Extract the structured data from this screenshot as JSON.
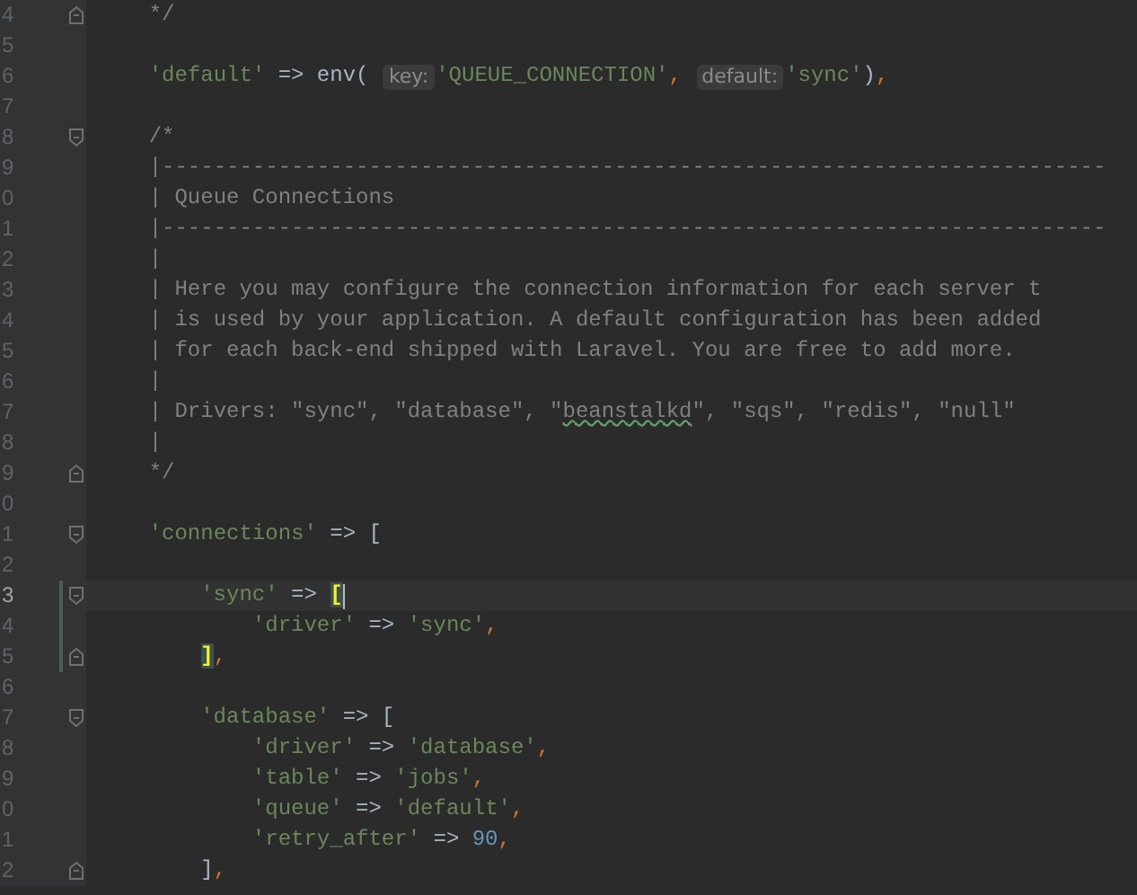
{
  "lines": [
    {
      "number": "4",
      "fold": {
        "kind": "end"
      },
      "current": false,
      "changed": false,
      "tokens": [
        {
          "t": "    */",
          "kind": "comment"
        }
      ]
    },
    {
      "number": "5",
      "current": false,
      "changed": false
    },
    {
      "number": "6",
      "current": false,
      "changed": false,
      "tokens": [
        {
          "t": "    'default'",
          "kind": "string"
        },
        {
          "t": " => env( ",
          "kind": "plain"
        },
        {
          "t": "key:",
          "kind": "hint"
        },
        {
          "t": "'QUEUE_CONNECTION'",
          "kind": "string"
        },
        {
          "t": ", ",
          "kind": "comma"
        },
        {
          "t": "default:",
          "kind": "hint"
        },
        {
          "t": "'sync'",
          "kind": "string"
        },
        {
          "t": ")",
          "kind": "plain"
        },
        {
          "t": ",",
          "kind": "comma"
        }
      ]
    },
    {
      "number": "7",
      "current": false,
      "changed": false
    },
    {
      "number": "8",
      "fold": {
        "kind": "start"
      },
      "current": false,
      "changed": false,
      "tokens": [
        {
          "t": "    /*",
          "kind": "comment"
        }
      ]
    },
    {
      "number": "9",
      "current": false,
      "changed": false,
      "tokens": [
        {
          "t": "    |-------------------------------------------------------------------------",
          "kind": "comment"
        }
      ]
    },
    {
      "number": "0",
      "current": false,
      "changed": false,
      "tokens": [
        {
          "t": "    | Queue Connections",
          "kind": "comment"
        }
      ]
    },
    {
      "number": "1",
      "current": false,
      "changed": false,
      "tokens": [
        {
          "t": "    |-------------------------------------------------------------------------",
          "kind": "comment"
        }
      ]
    },
    {
      "number": "2",
      "current": false,
      "changed": false,
      "tokens": [
        {
          "t": "    |",
          "kind": "comment"
        }
      ]
    },
    {
      "number": "3",
      "current": false,
      "changed": false,
      "tokens": [
        {
          "t": "    | Here you may configure the connection information for each server t",
          "kind": "comment"
        }
      ]
    },
    {
      "number": "4",
      "current": false,
      "changed": false,
      "tokens": [
        {
          "t": "    | is used by your application. A default configuration has been added",
          "kind": "comment"
        }
      ]
    },
    {
      "number": "5",
      "current": false,
      "changed": false,
      "tokens": [
        {
          "t": "    | for each back-end shipped with Laravel. You are free to add more.",
          "kind": "comment"
        }
      ]
    },
    {
      "number": "6",
      "current": false,
      "changed": false,
      "tokens": [
        {
          "t": "    |",
          "kind": "comment"
        }
      ]
    },
    {
      "number": "7",
      "current": false,
      "changed": false,
      "tokens": [
        {
          "t": "    | Drivers: \"sync\", \"database\", \"",
          "kind": "comment"
        },
        {
          "t": "beanstalkd",
          "kind": "typo"
        },
        {
          "t": "\", \"sqs\", \"redis\", \"null\"",
          "kind": "comment"
        }
      ]
    },
    {
      "number": "8",
      "current": false,
      "changed": false,
      "tokens": [
        {
          "t": "    |",
          "kind": "comment"
        }
      ]
    },
    {
      "number": "9",
      "fold": {
        "kind": "end"
      },
      "current": false,
      "changed": false,
      "tokens": [
        {
          "t": "    */",
          "kind": "comment"
        }
      ]
    },
    {
      "number": "0",
      "current": false,
      "changed": false
    },
    {
      "number": "1",
      "fold": {
        "kind": "start"
      },
      "current": false,
      "changed": false,
      "tokens": [
        {
          "t": "    'connections'",
          "kind": "string"
        },
        {
          "t": " => [",
          "kind": "plain"
        }
      ]
    },
    {
      "number": "2",
      "current": false,
      "changed": false
    },
    {
      "number": "3",
      "fold": {
        "kind": "start"
      },
      "current": true,
      "changed": true,
      "tokens": [
        {
          "t": "        'sync'",
          "kind": "string"
        },
        {
          "t": " => ",
          "kind": "plain"
        },
        {
          "t": "[",
          "kind": "match"
        }
      ]
    },
    {
      "number": "4",
      "current": false,
      "changed": true,
      "tokens": [
        {
          "t": "            'driver'",
          "kind": "string"
        },
        {
          "t": " => ",
          "kind": "plain"
        },
        {
          "t": "'sync'",
          "kind": "string"
        },
        {
          "t": ",",
          "kind": "comma"
        }
      ]
    },
    {
      "number": "5",
      "fold": {
        "kind": "end"
      },
      "current": false,
      "changed": true,
      "tokens": [
        {
          "t": "        ]",
          "kind": "match"
        },
        {
          "t": ",",
          "kind": "comma"
        }
      ]
    },
    {
      "number": "6",
      "current": false,
      "changed": false
    },
    {
      "number": "7",
      "fold": {
        "kind": "start"
      },
      "current": false,
      "changed": false,
      "tokens": [
        {
          "t": "        'database'",
          "kind": "string"
        },
        {
          "t": " => [",
          "kind": "plain"
        }
      ]
    },
    {
      "number": "8",
      "current": false,
      "changed": false,
      "tokens": [
        {
          "t": "            'driver'",
          "kind": "string"
        },
        {
          "t": " => ",
          "kind": "plain"
        },
        {
          "t": "'database'",
          "kind": "string"
        },
        {
          "t": ",",
          "kind": "comma"
        }
      ]
    },
    {
      "number": "9",
      "current": false,
      "changed": false,
      "tokens": [
        {
          "t": "            'table'",
          "kind": "string"
        },
        {
          "t": " => ",
          "kind": "plain"
        },
        {
          "t": "'jobs'",
          "kind": "string"
        },
        {
          "t": ",",
          "kind": "comma"
        }
      ]
    },
    {
      "number": "0",
      "current": false,
      "changed": false,
      "tokens": [
        {
          "t": "            'queue'",
          "kind": "string"
        },
        {
          "t": " => ",
          "kind": "plain"
        },
        {
          "t": "'default'",
          "kind": "string"
        },
        {
          "t": ",",
          "kind": "comma"
        }
      ]
    },
    {
      "number": "1",
      "current": false,
      "changed": false,
      "tokens": [
        {
          "t": "            'retry_after'",
          "kind": "string"
        },
        {
          "t": " => ",
          "kind": "plain"
        },
        {
          "t": "90",
          "kind": "number"
        },
        {
          "t": ",",
          "kind": "comma"
        }
      ]
    },
    {
      "number": "2",
      "fold": {
        "kind": "end"
      },
      "current": false,
      "changed": false,
      "tokens": [
        {
          "t": "        ]",
          "kind": "plain"
        },
        {
          "t": ",",
          "kind": "comma"
        }
      ]
    }
  ]
}
